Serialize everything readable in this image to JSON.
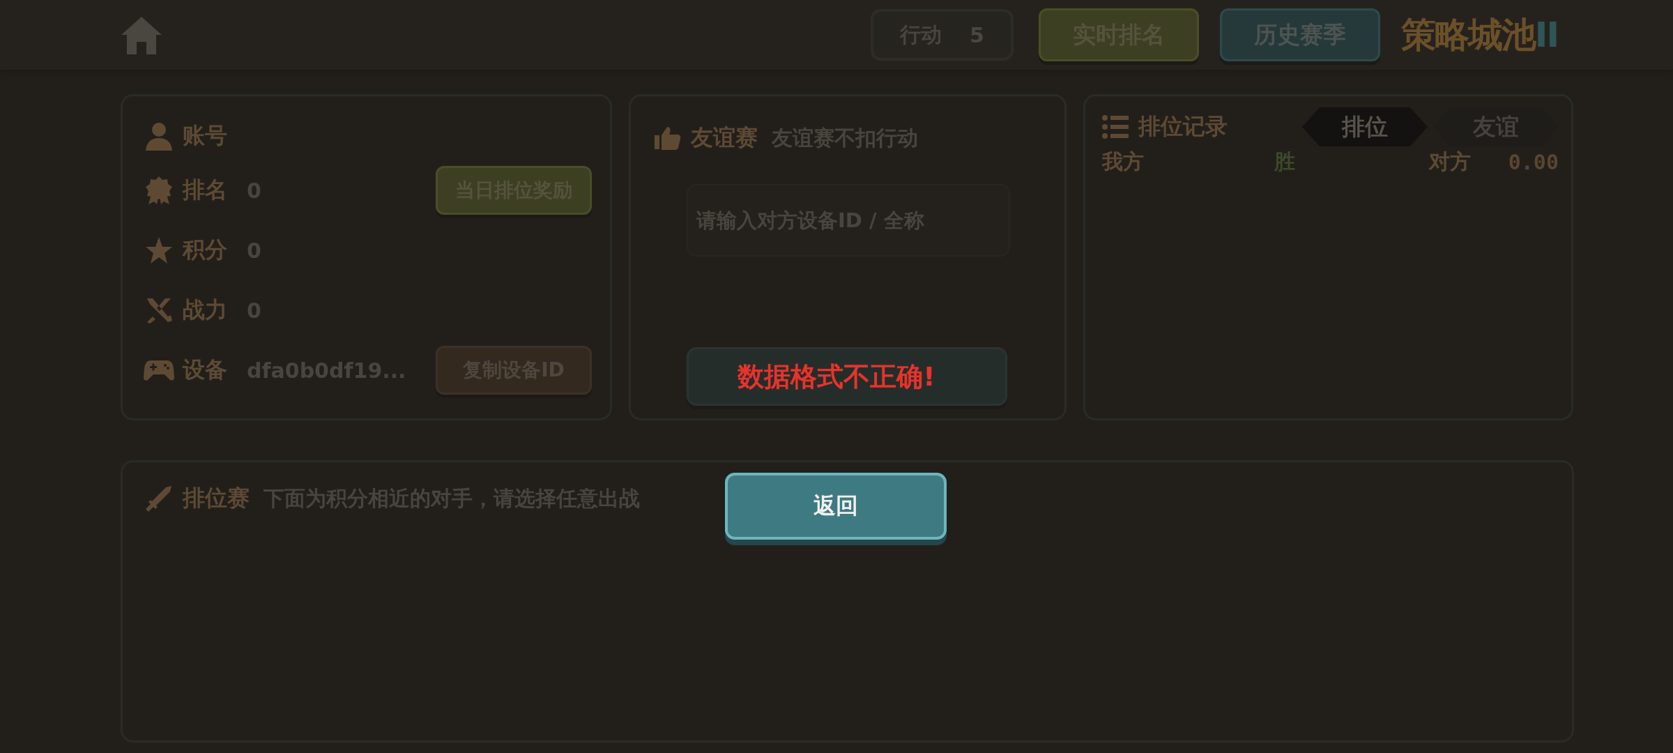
{
  "top_bar": {
    "action": {
      "label": "行动",
      "value": "5"
    },
    "buttons": [
      {
        "label": "实时排名",
        "kind": "olive"
      },
      {
        "label": "历史赛季",
        "kind": "teal"
      }
    ],
    "logo": {
      "text": "策略城池",
      "suffix": "II"
    }
  },
  "account": {
    "title": "账号",
    "rows": [
      {
        "kind": "rank",
        "label": "排名",
        "value": "0",
        "button": {
          "label": "当日排位奖励",
          "kind": "olive"
        }
      },
      {
        "kind": "score",
        "label": "积分",
        "value": "0"
      },
      {
        "kind": "power",
        "label": "战力",
        "value": "0"
      },
      {
        "kind": "device",
        "label": "设备",
        "value": "dfa0b0df19...",
        "button": {
          "label": "复制设备ID",
          "kind": "brown"
        }
      }
    ]
  },
  "friendly": {
    "title": "友谊赛",
    "subtitle": "友谊赛不扣行动",
    "input": {
      "placeholder": "请输入对方设备ID / 全称"
    }
  },
  "records": {
    "title": "排位记录",
    "tabs": [
      {
        "label": "排位",
        "selected": true
      },
      {
        "label": "友谊",
        "selected": false
      }
    ],
    "rows": [
      {
        "mine": "我方",
        "result": "胜",
        "opponent": "对方",
        "score": "0.00"
      }
    ]
  },
  "ranked": {
    "title": "排位赛",
    "subtitle": "下面为积分相近的对手，请选择任意出战"
  },
  "dialog": {
    "message": "数据格式不正确!",
    "button": "返回"
  }
}
